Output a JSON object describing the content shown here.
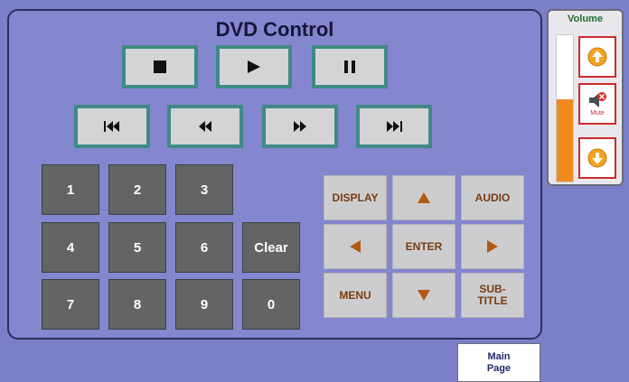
{
  "title": "DVD Control",
  "transport": {
    "row1": [
      {
        "name": "stop",
        "icon": "stop-icon"
      },
      {
        "name": "play",
        "icon": "play-icon"
      },
      {
        "name": "pause",
        "icon": "pause-icon"
      }
    ],
    "row2": [
      {
        "name": "previous-chapter",
        "icon": "skip-back-icon"
      },
      {
        "name": "rewind",
        "icon": "rewind-icon"
      },
      {
        "name": "fast-forward",
        "icon": "fast-forward-icon"
      },
      {
        "name": "next-chapter",
        "icon": "skip-forward-icon"
      }
    ]
  },
  "keypad": {
    "keys": [
      "1",
      "2",
      "3",
      "4",
      "5",
      "6",
      "Clear",
      "7",
      "8",
      "9",
      "0"
    ]
  },
  "navigation": {
    "display": "DISPLAY",
    "audio": "AUDIO",
    "enter": "ENTER",
    "menu": "MENU",
    "subtitle": "SUB-\nTITLE",
    "arrow_color": "#b25a12"
  },
  "volume": {
    "title": "Volume",
    "level_percent": 56,
    "mute_label": "Mute",
    "fill_color": "#f08a1c"
  },
  "main_page": {
    "label": "Main\nPage"
  }
}
